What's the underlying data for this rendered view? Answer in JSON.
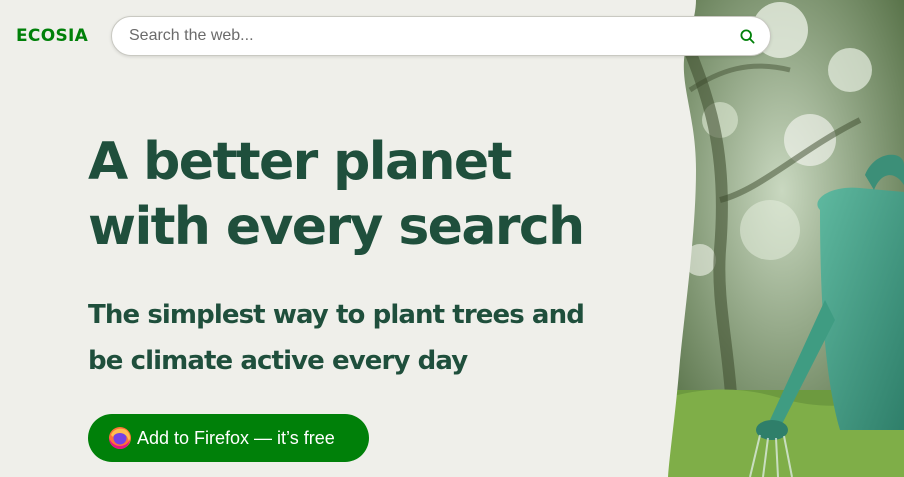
{
  "brand": {
    "logo_text": "ECOSIA",
    "accent_color": "#008009",
    "text_color": "#1f4f3c"
  },
  "search": {
    "placeholder": "Search the web...",
    "value": "",
    "icon": "search-icon"
  },
  "hero": {
    "headline_line1": "A better planet",
    "headline_line2": "with every search",
    "sub_line1": "The simplest way to plant trees and",
    "sub_line2": "be climate active every day",
    "cta_label": "Add to Firefox — it’s free",
    "cta_icon": "firefox-icon",
    "image": "watering-can-in-garden"
  }
}
